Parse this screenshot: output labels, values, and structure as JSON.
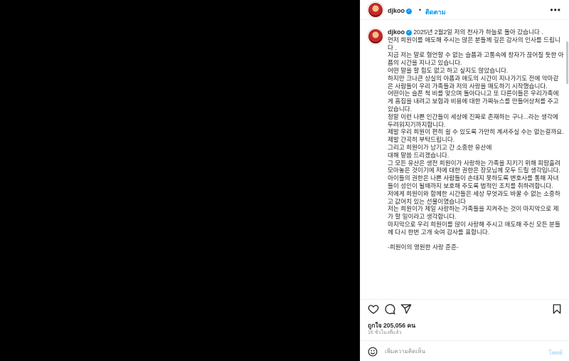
{
  "post": {
    "username": "djkoo",
    "follow_label": "ติดตาม",
    "more_icon": "more-horizontal-icon",
    "dot": "•",
    "verified_mark": "✓"
  },
  "caption": {
    "lines": [
      "2025년 2월2일 저의 천사가 하늘로 돌아 갔습니다 .",
      "먼저 희원이를 애도해 주시는 많은 분들께 깊은 감사의 인사를 드립니다 .",
      "지금 저는 말로 형언할 수 없는 슬픔과 고통속에 창자가 끊어질 듯한 아픔의 시간을 지나고 있습니다.",
      "어떤 말을 할 힘도 없고 하고 싶지도 않았습니다.",
      "하지만 크나큰 상실의 아픔과 애도의 시간이 지나가기도 전에 악마같은 사람들이 우리 가족들과 저의 사랑을 매도하기 시작했습니다.",
      "어떤이는 슬픈 척 비를 맞으며 돌아다니고 또 다른이들은 우리가족에게 흠집을 내려고 보험과 비용에 대한 가짜뉴스를 만들어상처를 주고 있습니다.",
      "정말 이런 나쁜 인간들이 세상에 진짜로 존재하는 구나...라는 생각에 두려워지기까지합니다.",
      "제발 우리 희원이 편히 쉴 수 있도록 가만히 계셔주실 수는 없는걸까요.",
      "제발 간곡히 부탁드립니다.",
      "그리고 희원이가 남기고 간 소중한 유산에",
      "대해 말씀 드리겠습니다.",
      "그 모든 유산은 생전 희원이가 사랑하는 가족을 지키기 위해 피땀흘려 모아놓은 것이기에 저에 대한 권한은 장모님께 모두 드릴 생각입니다.",
      "아이들의 권한은 나쁜 사람들이 손대지 못하도록 변호사를 통해 자녀들이 성인이 될때까지 보호해 주도록 법적인 조치를 취하려합니다.",
      "저에게 희원이와 함께한 시간들은 세상 무엇과도 바꿀 수 없는 소중하고 값어치 있는 선물이였습니다",
      "저는 희원이가 제일 사랑하는 가족들을 지켜주는 것이 마지막으로 제가 할 일이라고 생각합니다.",
      "마지막으로 우리 희원이를 많이 사랑해 주시고 애도해 주신 모든 분들께 다시 한번 고개 숙여 감사를 표합니다.",
      "",
      "-희원이의 영원한 사랑 준준-"
    ]
  },
  "actions": {
    "like_icon": "heart-icon",
    "comment_icon": "comment-icon",
    "share_icon": "share-icon",
    "save_icon": "bookmark-icon"
  },
  "stats": {
    "likes_text": "ถูกใจ 205,056 คน",
    "time_text": "16 ชั่วโมงที่แล้ว"
  },
  "comment": {
    "emoji_icon": "emoji-icon",
    "placeholder": "เพิ่มความคิดเห็น",
    "post_label": "โพสต์"
  },
  "colors": {
    "accent": "#0095f6",
    "post_disabled": "#b3dbff",
    "muted": "#8e8e8e",
    "text": "#262626"
  }
}
